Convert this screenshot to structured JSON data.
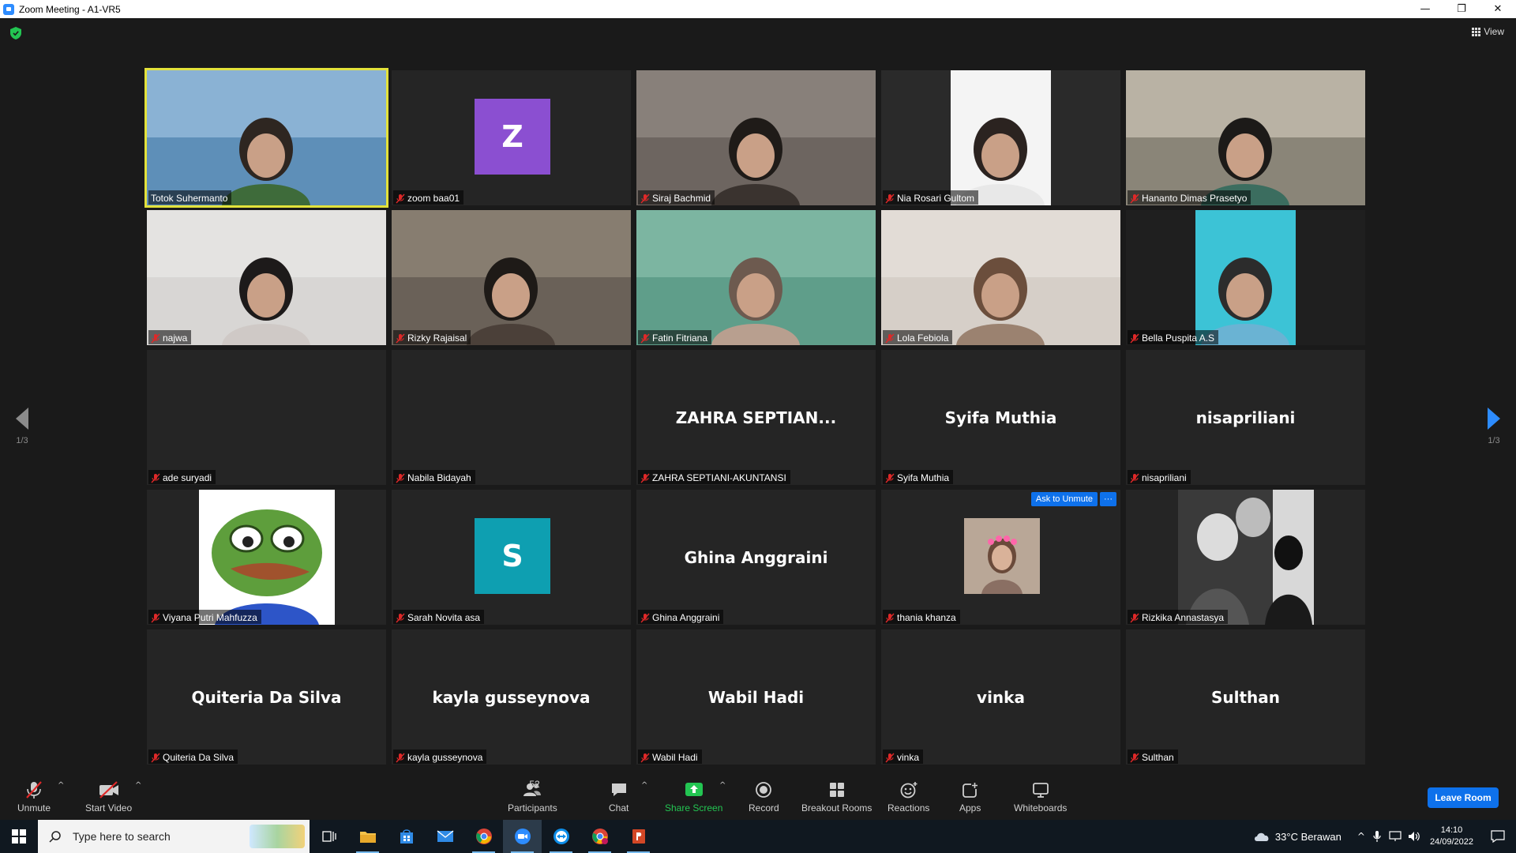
{
  "window": {
    "title": "Zoom Meeting - A1-VR5",
    "minimize_glyph": "—",
    "restore_glyph": "❐",
    "close_glyph": "✕"
  },
  "top_bar": {
    "view_label": "View"
  },
  "pagination": {
    "left_label": "1/3",
    "right_label": "1/3"
  },
  "participants": [
    {
      "name": "Totok Suhermanto",
      "muted": false,
      "kind": "video"
    },
    {
      "name": "zoom baa01",
      "muted": true,
      "kind": "avatar",
      "letter": "Z",
      "avatar_color": "#8b4fd1"
    },
    {
      "name": "Siraj Bachmid",
      "muted": true,
      "kind": "video"
    },
    {
      "name": "Nia Rosari Gultom",
      "muted": true,
      "kind": "video"
    },
    {
      "name": "Hananto Dimas Prasetyo",
      "muted": true,
      "kind": "video"
    },
    {
      "name": "najwa",
      "muted": true,
      "kind": "video"
    },
    {
      "name": "Rizky Rajaisal",
      "muted": true,
      "kind": "video"
    },
    {
      "name": "Fatin Fitriana",
      "muted": true,
      "kind": "video"
    },
    {
      "name": "Lola Febiola",
      "muted": true,
      "kind": "video"
    },
    {
      "name": "Bella Puspita A.S",
      "muted": true,
      "kind": "video"
    },
    {
      "name": "ade suryadi",
      "muted": true,
      "kind": "blank"
    },
    {
      "name": "Nabila Bidayah",
      "muted": true,
      "kind": "blank"
    },
    {
      "name": "ZAHRA SEPTIANI-AKUNTANSI",
      "muted": true,
      "kind": "name",
      "display": "ZAHRA  SEPTIAN..."
    },
    {
      "name": "Syifa Muthia",
      "muted": true,
      "kind": "name",
      "display": "Syifa Muthia"
    },
    {
      "name": "nisapriliani",
      "muted": true,
      "kind": "name",
      "display": "nisapriliani"
    },
    {
      "name": "Viyana Putri Mahfuzza",
      "muted": true,
      "kind": "photo"
    },
    {
      "name": "Sarah Novita asa",
      "muted": true,
      "kind": "avatar",
      "letter": "S",
      "avatar_color": "#0e9fb1"
    },
    {
      "name": "Ghina Anggraini",
      "muted": true,
      "kind": "name",
      "display": "Ghina Anggraini"
    },
    {
      "name": "thania khanza",
      "muted": true,
      "kind": "photo",
      "ask_unmute": "Ask to Unmute",
      "more": "···"
    },
    {
      "name": "Rizkika Annastasya",
      "muted": true,
      "kind": "photo"
    },
    {
      "name": "Quiteria Da Silva",
      "muted": true,
      "kind": "name",
      "display": "Quiteria Da Silva"
    },
    {
      "name": "kayla gusseynova",
      "muted": true,
      "kind": "name",
      "display": "kayla gusseynova"
    },
    {
      "name": "Wabil Hadi",
      "muted": true,
      "kind": "name",
      "display": "Wabil Hadi"
    },
    {
      "name": "vinka",
      "muted": true,
      "kind": "name",
      "display": "vinka"
    },
    {
      "name": "Sulthan",
      "muted": true,
      "kind": "name",
      "display": "Sulthan"
    }
  ],
  "toolbar": {
    "unmute": "Unmute",
    "start_video": "Start Video",
    "participants": "Participants",
    "participants_count": "52",
    "chat": "Chat",
    "share_screen": "Share Screen",
    "record": "Record",
    "breakout_rooms": "Breakout Rooms",
    "reactions": "Reactions",
    "apps": "Apps",
    "whiteboards": "Whiteboards",
    "leave_room": "Leave Room",
    "caret": "^"
  },
  "taskbar": {
    "search_placeholder": "Type here to search",
    "weather": "33°C  Berawan",
    "time": "14:10",
    "date": "24/09/2022"
  },
  "colors": {
    "accent": "#0e71eb",
    "active_speaker": "#e3e23b",
    "share_green": "#23c552",
    "muted_red": "#e02828"
  }
}
